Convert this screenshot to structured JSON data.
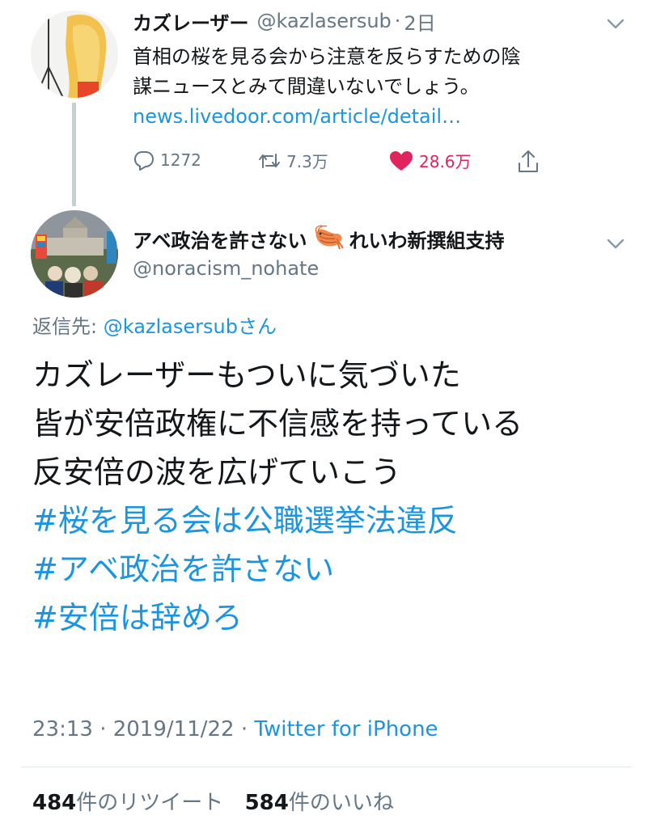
{
  "reply_parent": {
    "display_name": "カズレーザー",
    "handle": "@kazlasersub",
    "time_sep": "·",
    "time_ago": "2日",
    "text_line1": "首相の桜を見る会から注意を反らすための陰",
    "text_line2": "謀ニュースとみて間違いないでしょう。",
    "link": "news.livedoor.com/article/detail…",
    "actions": {
      "reply_count": "1272",
      "retweet_count": "7.3万",
      "like_count": "28.6万"
    },
    "colors": {
      "like": "#e0245e"
    }
  },
  "main_tweet": {
    "display_name_part1": "アベ政治を許さない",
    "display_name_part2": "れいわ新撰組支持",
    "emoji_name": "shrimp-icon",
    "handle": "@noracism_nohate",
    "reply_to_label": "返信先:",
    "reply_to_handle": "@kazlasersubさん",
    "body_lines": [
      "カズレーザーもついに気づいた",
      "皆が安倍政権に不信感を持っている",
      "反安倍の波を広げていこう"
    ],
    "hashtags": [
      "#桜を見る会は公職選挙法違反",
      "#アベ政治を許さない",
      "#安倍は辞めろ"
    ],
    "timestamp": "23:13 · 2019/11/22 · ",
    "client": "Twitter for iPhone",
    "stats": {
      "retweets_num": "484",
      "retweets_label": "件のリツイート",
      "likes_num": "584",
      "likes_label": "件のいいね"
    },
    "colors": {
      "link": "#1b95e0",
      "muted": "#657786"
    }
  }
}
